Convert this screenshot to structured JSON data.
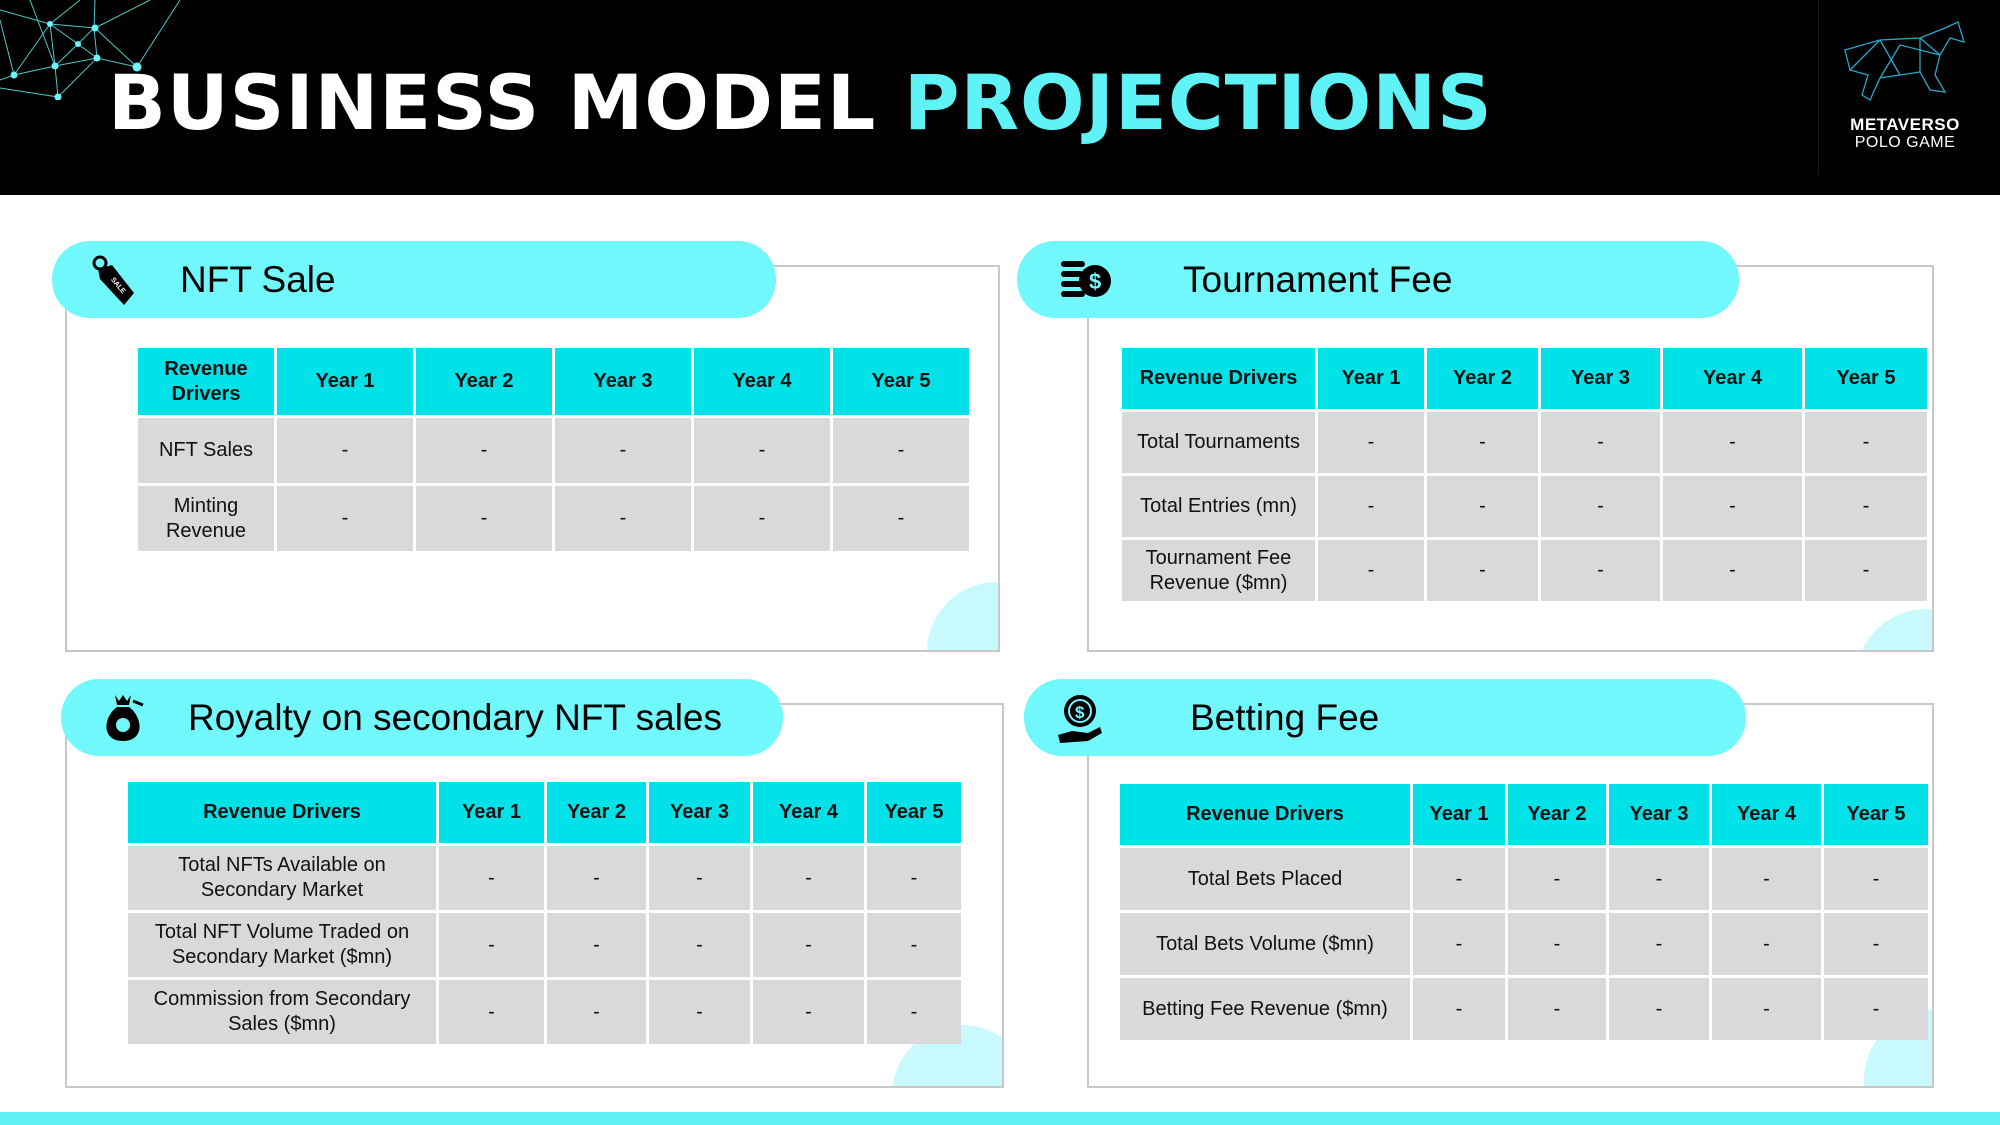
{
  "header": {
    "title_main": "BUSINESS MODEL",
    "title_accent": "PROJECTIONS",
    "logo_line1": "METAVERSO",
    "logo_line2": "POLO GAME"
  },
  "colors": {
    "pill": "#70f8fc",
    "table_header": "#00e2e8",
    "cell": "#d9d9d9",
    "accent": "#5ff3f7"
  },
  "panels": [
    {
      "title": "NFT Sale",
      "icon": "sale-tag-icon",
      "columns": [
        "Revenue Drivers",
        "Year 1",
        "Year 2",
        "Year 3",
        "Year 4",
        "Year 5"
      ],
      "rows": [
        [
          "NFT Sales",
          "-",
          "-",
          "-",
          "-",
          "-"
        ],
        [
          "Minting Revenue",
          "-",
          "-",
          "-",
          "-",
          "-"
        ]
      ]
    },
    {
      "title": "Tournament Fee",
      "icon": "coin-stack-dollar-icon",
      "columns": [
        "Revenue Drivers",
        "Year 1",
        "Year 2",
        "Year 3",
        "Year 4",
        "Year 5"
      ],
      "rows": [
        [
          "Total Tournaments",
          "-",
          "-",
          "-",
          "-",
          "-"
        ],
        [
          "Total Entries (mn)",
          "-",
          "-",
          "-",
          "-",
          "-"
        ],
        [
          "Tournament Fee Revenue ($mn)",
          "-",
          "-",
          "-",
          "-",
          "-"
        ]
      ]
    },
    {
      "title": "Royalty on secondary NFT sales",
      "icon": "money-bag-crown-icon",
      "columns": [
        "Revenue Drivers",
        "Year 1",
        "Year 2",
        "Year 3",
        "Year 4",
        "Year 5"
      ],
      "rows": [
        [
          "Total NFTs Available on Secondary Market",
          "-",
          "-",
          "-",
          "-",
          "-"
        ],
        [
          "Total NFT Volume Traded on Secondary Market ($mn)",
          "-",
          "-",
          "-",
          "-",
          "-"
        ],
        [
          "Commission from Secondary Sales ($mn)",
          "-",
          "-",
          "-",
          "-",
          "-"
        ]
      ]
    },
    {
      "title": "Betting Fee",
      "icon": "hand-coin-icon",
      "columns": [
        "Revenue Drivers",
        "Year 1",
        "Year 2",
        "Year 3",
        "Year 4",
        "Year 5"
      ],
      "rows": [
        [
          "Total Bets Placed",
          "-",
          "-",
          "-",
          "-",
          "-"
        ],
        [
          "Total Bets Volume ($mn)",
          "-",
          "-",
          "-",
          "-",
          "-"
        ],
        [
          "Betting Fee Revenue ($mn)",
          "-",
          "-",
          "-",
          "-",
          "-"
        ]
      ]
    }
  ]
}
